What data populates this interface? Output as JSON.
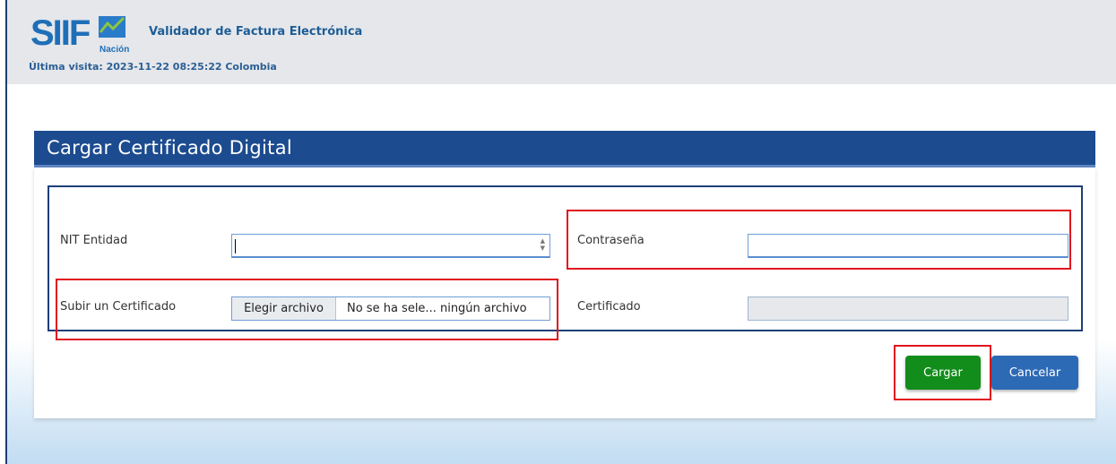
{
  "header": {
    "logo_text": "SIIF Nación",
    "app_title": "Validador de Factura Electrónica",
    "last_visit": "Última visita: 2023-11-22 08:25:22 Colombia"
  },
  "panel": {
    "title": "Cargar Certificado Digital"
  },
  "form": {
    "nit_label": "NIT Entidad",
    "nit_value": "",
    "password_label": "Contraseña",
    "password_value": "",
    "upload_label": "Subir un Certificado",
    "file_button_label": "Elegir archivo",
    "file_status": "No se ha sele... ningún archivo",
    "certificate_label": "Certificado",
    "certificate_value": ""
  },
  "buttons": {
    "submit_label": "Cargar",
    "cancel_label": "Cancelar"
  },
  "colors": {
    "title_bar": "#1c4b8f",
    "header_bg": "#e5e7eb",
    "submit": "#128c1b",
    "cancel": "#2d6ab5",
    "highlight": "#e0141e"
  }
}
